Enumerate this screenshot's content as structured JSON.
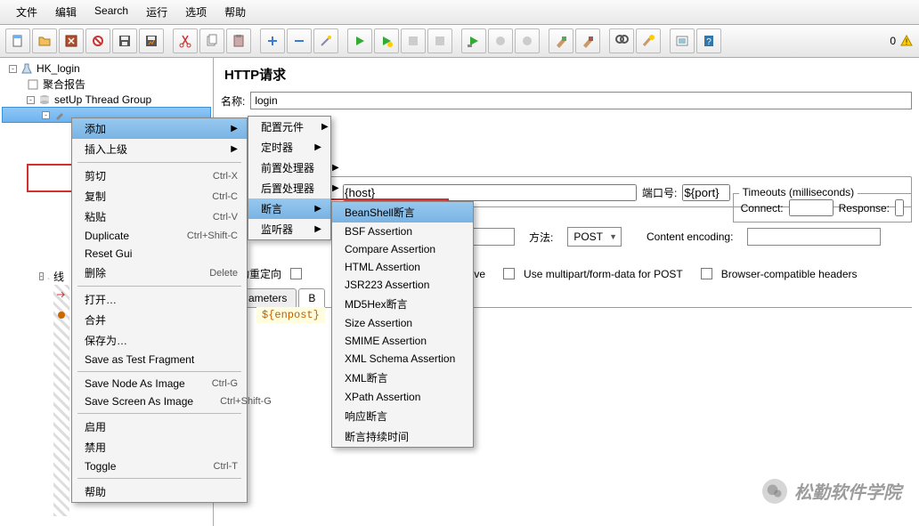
{
  "menu": {
    "items": [
      "文件",
      "编辑",
      "Search",
      "运行",
      "选项",
      "帮助"
    ]
  },
  "tree": {
    "root": "HK_login",
    "nodes": [
      "聚合报告",
      "setUp Thread Group"
    ],
    "threadNode": "线"
  },
  "context1": {
    "items": [
      {
        "label": "添加",
        "arrow": true,
        "sel": true
      },
      {
        "label": "插入上级",
        "arrow": true
      },
      {
        "sep": true
      },
      {
        "label": "剪切",
        "shortcut": "Ctrl-X"
      },
      {
        "label": "复制",
        "shortcut": "Ctrl-C"
      },
      {
        "label": "粘贴",
        "shortcut": "Ctrl-V"
      },
      {
        "label": "Duplicate",
        "shortcut": "Ctrl+Shift-C"
      },
      {
        "label": "Reset Gui"
      },
      {
        "label": "删除",
        "shortcut": "Delete"
      },
      {
        "sep": true
      },
      {
        "label": "打开…"
      },
      {
        "label": "合并"
      },
      {
        "label": "保存为…"
      },
      {
        "label": "Save as Test Fragment"
      },
      {
        "sep": true
      },
      {
        "label": "Save Node As Image",
        "shortcut": "Ctrl-G"
      },
      {
        "label": "Save Screen As Image",
        "shortcut": "Ctrl+Shift-G"
      },
      {
        "sep": true
      },
      {
        "label": "启用"
      },
      {
        "label": "禁用"
      },
      {
        "label": "Toggle",
        "shortcut": "Ctrl-T"
      },
      {
        "sep": true
      },
      {
        "label": "帮助"
      }
    ]
  },
  "context2": {
    "items": [
      {
        "label": "配置元件",
        "arrow": true
      },
      {
        "label": "定时器",
        "arrow": true
      },
      {
        "label": "前置处理器",
        "arrow": true
      },
      {
        "label": "后置处理器",
        "arrow": true
      },
      {
        "label": "断言",
        "arrow": true,
        "sel": true
      },
      {
        "label": "监听器",
        "arrow": true
      }
    ]
  },
  "context3": {
    "items": [
      {
        "label": "BeanShell断言",
        "sel": true
      },
      {
        "label": "BSF Assertion"
      },
      {
        "label": "Compare Assertion"
      },
      {
        "label": "HTML Assertion"
      },
      {
        "label": "JSR223 Assertion"
      },
      {
        "label": "MD5Hex断言"
      },
      {
        "label": "Size Assertion"
      },
      {
        "label": "SMIME Assertion"
      },
      {
        "label": "XML Schema Assertion"
      },
      {
        "label": "XML断言"
      },
      {
        "label": "XPath Assertion"
      },
      {
        "label": "响应断言"
      },
      {
        "label": "断言持续时间"
      }
    ]
  },
  "panel": {
    "title": "HTTP请求",
    "nameLabel": "名称:",
    "nameValue": "login",
    "hostValue": "{host}",
    "portLabel": "端口号:",
    "portValue": "${port}",
    "timeoutsLegend": "Timeouts (milliseconds)",
    "connectLabel": "Connect:",
    "responseLabel": "Response:",
    "methodLabel": "方法:",
    "methodValue": "POST",
    "encodingLabel": "Content encoding:",
    "redirectLabel": "动重定向",
    "aliveLabel": "Alive",
    "multipartLabel": "Use multipart/form-data for POST",
    "browserLabel": "Browser-compatible headers",
    "tabA": "ameters",
    "tabB": "B",
    "bodyValue": "${enpost}"
  },
  "warnCount": "0",
  "watermark": "松勤软件学院"
}
